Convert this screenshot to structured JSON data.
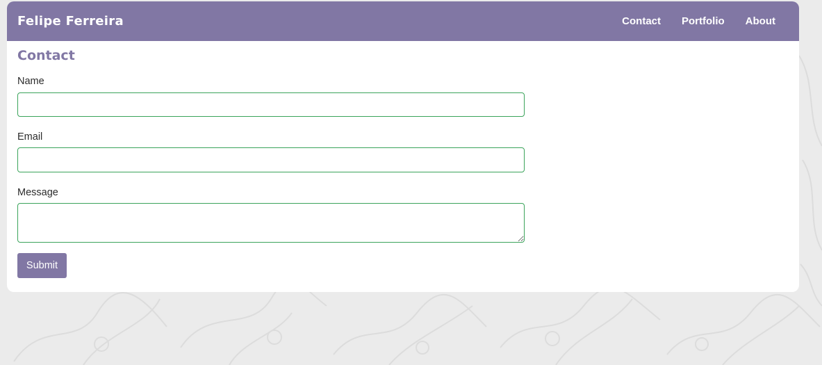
{
  "navbar": {
    "brand": "Felipe Ferreira",
    "links": [
      {
        "label": "Contact"
      },
      {
        "label": "Portfolio"
      },
      {
        "label": "About"
      }
    ]
  },
  "page": {
    "title": "Contact"
  },
  "form": {
    "name": {
      "label": "Name",
      "value": ""
    },
    "email": {
      "label": "Email",
      "value": ""
    },
    "message": {
      "label": "Message",
      "value": ""
    },
    "submit_label": "Submit"
  },
  "colors": {
    "accent": "#8177a4",
    "input_border": "#3aa35a",
    "page_background": "#ebebeb"
  }
}
